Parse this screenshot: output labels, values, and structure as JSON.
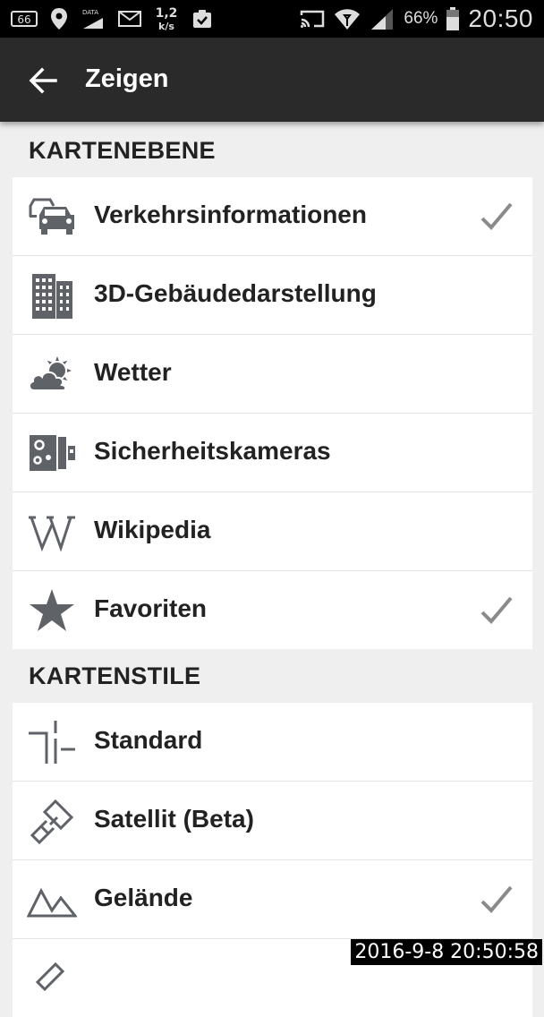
{
  "status_bar": {
    "left_icons": [
      "sim-66-icon",
      "location-pin-icon",
      "data-signal-icon",
      "mail-icon",
      "network-speed-icon",
      "clipboard-check-icon"
    ],
    "speed_value": "1,2",
    "speed_unit": "k/s",
    "data_label": "DATA",
    "sim_label": "66",
    "battery": "66%",
    "time": "20:50"
  },
  "app_bar": {
    "title": "Zeigen"
  },
  "sections": {
    "layers": {
      "title": "KARTENEBENE",
      "items": [
        {
          "label": "Verkehrsinformationen",
          "icon": "traffic-cars-icon",
          "checked": true
        },
        {
          "label": "3D-Gebäudedarstellung",
          "icon": "buildings-icon",
          "checked": false
        },
        {
          "label": "Wetter",
          "icon": "weather-icon",
          "checked": false
        },
        {
          "label": "Sicherheitskameras",
          "icon": "speed-camera-icon",
          "checked": false
        },
        {
          "label": "Wikipedia",
          "icon": "wikipedia-icon",
          "checked": false
        },
        {
          "label": "Favoriten",
          "icon": "star-icon",
          "checked": true
        }
      ]
    },
    "styles": {
      "title": "KARTENSTILE",
      "items": [
        {
          "label": "Standard",
          "icon": "road-junction-icon",
          "checked": false
        },
        {
          "label": "Satellit (Beta)",
          "icon": "satellite-icon",
          "checked": false
        },
        {
          "label": "Gelände",
          "icon": "terrain-icon",
          "checked": true
        }
      ]
    }
  },
  "timestamp": "2016-9-8 20:50:58",
  "colors": {
    "icon_gray": "#5f6368",
    "check_gray": "#8a8a8a",
    "app_bar": "#2a2a2a",
    "background": "#efefef"
  }
}
